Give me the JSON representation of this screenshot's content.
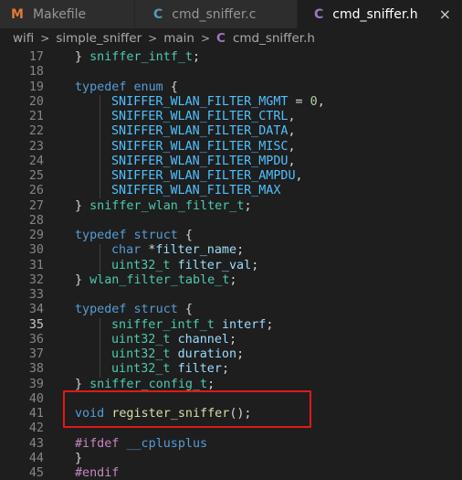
{
  "tabs": [
    {
      "icon": "M",
      "label": "Makefile",
      "active": false
    },
    {
      "icon": "C",
      "label": "cmd_sniffer.c",
      "active": false
    },
    {
      "icon": "C",
      "label": "cmd_sniffer.h",
      "active": true,
      "close": "×"
    }
  ],
  "breadcrumb": {
    "items": [
      "wifi",
      "simple_sniffer",
      "main"
    ],
    "separator": ">",
    "file_icon": "C",
    "file": "cmd_sniffer.h"
  },
  "editor": {
    "active_line": 35,
    "highlighted_line": 41,
    "lines": [
      {
        "n": "17",
        "tokens": [
          {
            "c": "pl",
            "t": "} "
          },
          {
            "c": "ty",
            "t": "sniffer_intf_t"
          },
          {
            "c": "pl",
            "t": ";"
          }
        ]
      },
      {
        "n": "18",
        "tokens": []
      },
      {
        "n": "19",
        "tokens": [
          {
            "c": "kw",
            "t": "typedef"
          },
          {
            "c": "pl",
            "t": " "
          },
          {
            "c": "kw",
            "t": "enum"
          },
          {
            "c": "pl",
            "t": " {"
          }
        ]
      },
      {
        "n": "20",
        "indent": true,
        "tokens": [
          {
            "c": "en",
            "t": "SNIFFER_WLAN_FILTER_MGMT"
          },
          {
            "c": "pl",
            "t": " = "
          },
          {
            "c": "nu",
            "t": "0"
          },
          {
            "c": "pl",
            "t": ","
          }
        ]
      },
      {
        "n": "21",
        "indent": true,
        "tokens": [
          {
            "c": "en",
            "t": "SNIFFER_WLAN_FILTER_CTRL"
          },
          {
            "c": "pl",
            "t": ","
          }
        ]
      },
      {
        "n": "22",
        "indent": true,
        "tokens": [
          {
            "c": "en",
            "t": "SNIFFER_WLAN_FILTER_DATA"
          },
          {
            "c": "pl",
            "t": ","
          }
        ]
      },
      {
        "n": "23",
        "indent": true,
        "tokens": [
          {
            "c": "en",
            "t": "SNIFFER_WLAN_FILTER_MISC"
          },
          {
            "c": "pl",
            "t": ","
          }
        ]
      },
      {
        "n": "24",
        "indent": true,
        "tokens": [
          {
            "c": "en",
            "t": "SNIFFER_WLAN_FILTER_MPDU"
          },
          {
            "c": "pl",
            "t": ","
          }
        ]
      },
      {
        "n": "25",
        "indent": true,
        "tokens": [
          {
            "c": "en",
            "t": "SNIFFER_WLAN_FILTER_AMPDU"
          },
          {
            "c": "pl",
            "t": ","
          }
        ]
      },
      {
        "n": "26",
        "indent": true,
        "tokens": [
          {
            "c": "en",
            "t": "SNIFFER_WLAN_FILTER_MAX"
          }
        ]
      },
      {
        "n": "27",
        "tokens": [
          {
            "c": "pl",
            "t": "} "
          },
          {
            "c": "ty",
            "t": "sniffer_wlan_filter_t"
          },
          {
            "c": "pl",
            "t": ";"
          }
        ]
      },
      {
        "n": "28",
        "tokens": []
      },
      {
        "n": "29",
        "tokens": [
          {
            "c": "kw",
            "t": "typedef"
          },
          {
            "c": "pl",
            "t": " "
          },
          {
            "c": "kw",
            "t": "struct"
          },
          {
            "c": "pl",
            "t": " {"
          }
        ]
      },
      {
        "n": "30",
        "indent": true,
        "tokens": [
          {
            "c": "kw",
            "t": "char"
          },
          {
            "c": "pl",
            "t": " *"
          },
          {
            "c": "va",
            "t": "filter_name"
          },
          {
            "c": "pl",
            "t": ";"
          }
        ]
      },
      {
        "n": "31",
        "indent": true,
        "tokens": [
          {
            "c": "ty",
            "t": "uint32_t"
          },
          {
            "c": "pl",
            "t": " "
          },
          {
            "c": "va",
            "t": "filter_val"
          },
          {
            "c": "pl",
            "t": ";"
          }
        ]
      },
      {
        "n": "32",
        "tokens": [
          {
            "c": "pl",
            "t": "} "
          },
          {
            "c": "ty",
            "t": "wlan_filter_table_t"
          },
          {
            "c": "pl",
            "t": ";"
          }
        ]
      },
      {
        "n": "33",
        "tokens": []
      },
      {
        "n": "34",
        "tokens": [
          {
            "c": "kw",
            "t": "typedef"
          },
          {
            "c": "pl",
            "t": " "
          },
          {
            "c": "kw",
            "t": "struct"
          },
          {
            "c": "pl",
            "t": " {"
          }
        ]
      },
      {
        "n": "35",
        "indent": true,
        "tokens": [
          {
            "c": "ty",
            "t": "sniffer_intf_t"
          },
          {
            "c": "pl",
            "t": " "
          },
          {
            "c": "va",
            "t": "interf"
          },
          {
            "c": "pl",
            "t": ";"
          }
        ]
      },
      {
        "n": "36",
        "indent": true,
        "tokens": [
          {
            "c": "ty",
            "t": "uint32_t"
          },
          {
            "c": "pl",
            "t": " "
          },
          {
            "c": "va",
            "t": "channel"
          },
          {
            "c": "pl",
            "t": ";"
          }
        ]
      },
      {
        "n": "37",
        "indent": true,
        "tokens": [
          {
            "c": "ty",
            "t": "uint32_t"
          },
          {
            "c": "pl",
            "t": " "
          },
          {
            "c": "va",
            "t": "duration"
          },
          {
            "c": "pl",
            "t": ";"
          }
        ]
      },
      {
        "n": "38",
        "indent": true,
        "tokens": [
          {
            "c": "ty",
            "t": "uint32_t"
          },
          {
            "c": "pl",
            "t": " "
          },
          {
            "c": "va",
            "t": "filter"
          },
          {
            "c": "pl",
            "t": ";"
          }
        ]
      },
      {
        "n": "39",
        "tokens": [
          {
            "c": "pl",
            "t": "} "
          },
          {
            "c": "ty",
            "t": "sniffer_config_t"
          },
          {
            "c": "pl",
            "t": ";"
          }
        ]
      },
      {
        "n": "40",
        "tokens": []
      },
      {
        "n": "41",
        "tokens": [
          {
            "c": "kw",
            "t": "void"
          },
          {
            "c": "pl",
            "t": " "
          },
          {
            "c": "fn",
            "t": "register_sniffer"
          },
          {
            "c": "pl",
            "t": "();"
          }
        ]
      },
      {
        "n": "42",
        "tokens": []
      },
      {
        "n": "43",
        "tokens": [
          {
            "c": "pp",
            "t": "#ifdef"
          },
          {
            "c": "pl",
            "t": " "
          },
          {
            "c": "mc",
            "t": "__cplusplus"
          }
        ]
      },
      {
        "n": "44",
        "tokens": [
          {
            "c": "pl",
            "t": "}"
          }
        ]
      },
      {
        "n": "45",
        "tokens": [
          {
            "c": "pp",
            "t": "#endif"
          }
        ]
      }
    ]
  },
  "colors": {
    "background": "#1e1e1e",
    "tab_inactive": "#2d2d2d",
    "highlight_box": "#e0191b"
  }
}
